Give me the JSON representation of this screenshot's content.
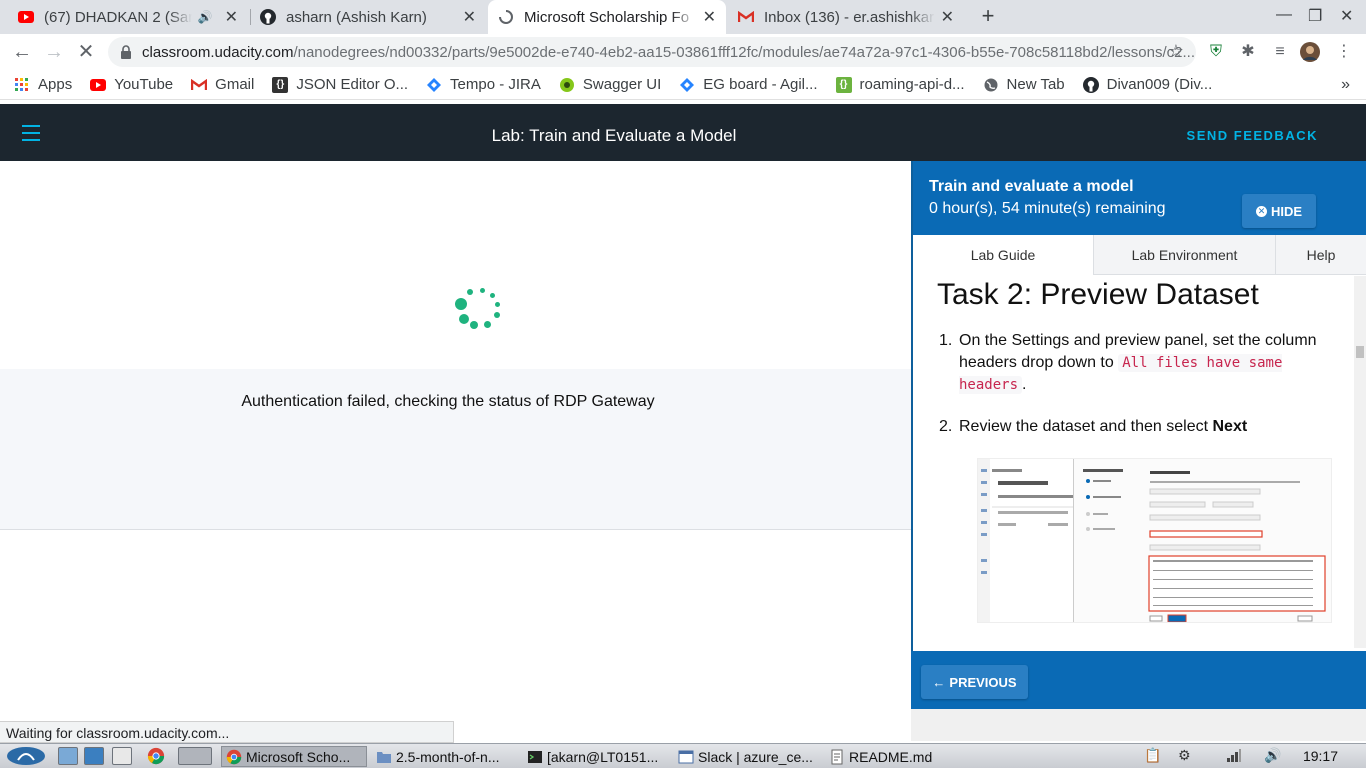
{
  "browser": {
    "tabs": [
      {
        "title": "(67) DHADKAN 2 (Sara",
        "icon": "youtube-icon"
      },
      {
        "title": "asharn (Ashish Karn)",
        "icon": "github-icon"
      },
      {
        "title": "Microsoft Scholarship Fo",
        "icon": "loading-icon"
      },
      {
        "title": "Inbox (136) - er.ashishkarn",
        "icon": "gmail-icon"
      }
    ],
    "url_host": "classroom.udacity.com",
    "url_path": "/nanodegrees/nd00332/parts/9e5002de-e740-4eb2-aa15-03861fff12fc/modules/ae74a72a-97c1-4306-b55e-708c58118bd2/lessons/c2...",
    "bookmarks": [
      {
        "label": "Apps"
      },
      {
        "label": "YouTube"
      },
      {
        "label": "Gmail"
      },
      {
        "label": "JSON Editor O..."
      },
      {
        "label": "Tempo - JIRA"
      },
      {
        "label": "Swagger UI"
      },
      {
        "label": "EG board - Agil..."
      },
      {
        "label": "roaming-api-d..."
      },
      {
        "label": "New Tab"
      },
      {
        "label": "Divan009 (Div..."
      }
    ],
    "more": "»",
    "status": "Waiting for classroom.udacity.com..."
  },
  "app": {
    "title": "Lab: Train and Evaluate a Model",
    "feedback": "SEND FEEDBACK"
  },
  "left": {
    "message": "Authentication failed, checking the status of RDP Gateway"
  },
  "lab": {
    "title": "Train and evaluate a model",
    "remaining": "0 hour(s), 54 minute(s) remaining",
    "hide": "HIDE",
    "tabs": [
      "Lab Guide",
      "Lab Environment",
      "Help"
    ],
    "heading": "Task 2: Preview Dataset",
    "step1_num": "1.",
    "step1_text": "On the Settings and preview panel, set the column headers drop down to",
    "step1_code": "All files have same headers",
    "step1_end": ".",
    "step2_num": "2.",
    "step2_text": "Review the dataset and then select",
    "step2_bold": "Next",
    "previous": "PREVIOUS"
  },
  "taskbar": {
    "tasks": [
      {
        "label": "Microsoft Scho..."
      },
      {
        "label": "2.5-month-of-n..."
      },
      {
        "label": "[akarn@LT0151..."
      },
      {
        "label": "Slack | azure_ce..."
      },
      {
        "label": "README.md"
      }
    ],
    "clock": "19:17"
  },
  "colors": {
    "header_dark": "#1c262f",
    "accent_cyan": "#02b3e4",
    "lab_blue": "#0a6ab5",
    "spinner_green": "#1fb37f"
  }
}
